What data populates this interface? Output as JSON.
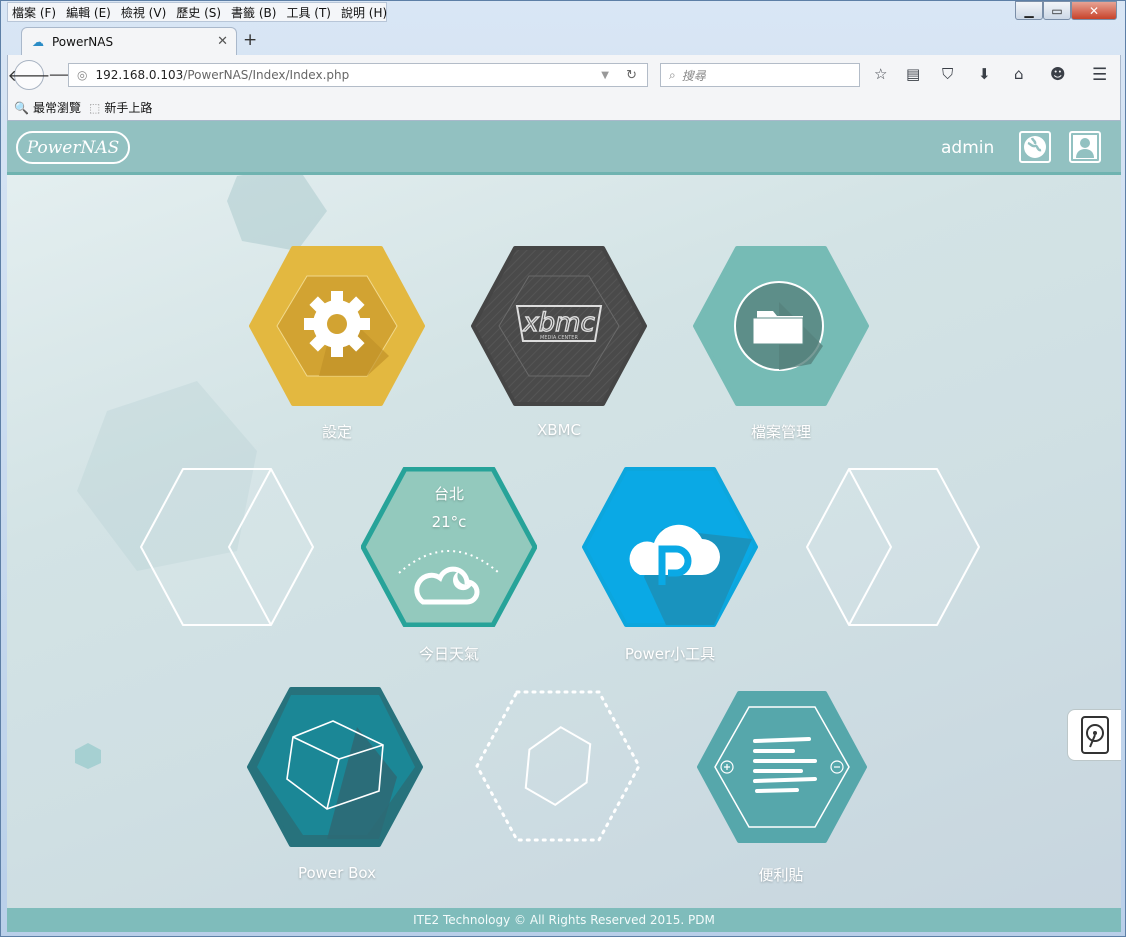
{
  "browser": {
    "menu": [
      "檔案 (F)",
      "編輯 (E)",
      "檢視 (V)",
      "歷史 (S)",
      "書籤 (B)",
      "工具 (T)",
      "說明 (H)"
    ],
    "tab_title": "PowerNAS",
    "url_host": "192.168.0.103",
    "url_path": "/PowerNAS/Index/Index.php",
    "search_placeholder": "搜尋",
    "bookmarks": [
      "最常瀏覽",
      "新手上路"
    ]
  },
  "header": {
    "logo": "PowerNAS",
    "username": "admin"
  },
  "tiles": {
    "settings": "設定",
    "xbmc": "XBMC",
    "files": "檔案管理",
    "weather_city": "台北",
    "weather_temp": "21°c",
    "weather": "今日天氣",
    "power_tools": "Power小工具",
    "power_box": "Power Box",
    "notes": "便利貼"
  },
  "footer": "ITE2 Technology © All Rights Reserved 2015. PDM",
  "colors": {
    "settings": "#e3b840",
    "xbmc": "#454545",
    "files": "#76bbb5",
    "weather": "#93c9bd",
    "power_tools": "#0aa9e5",
    "power_box": "#27727c",
    "notes": "#56a7ab",
    "header": "#92c1c1"
  }
}
